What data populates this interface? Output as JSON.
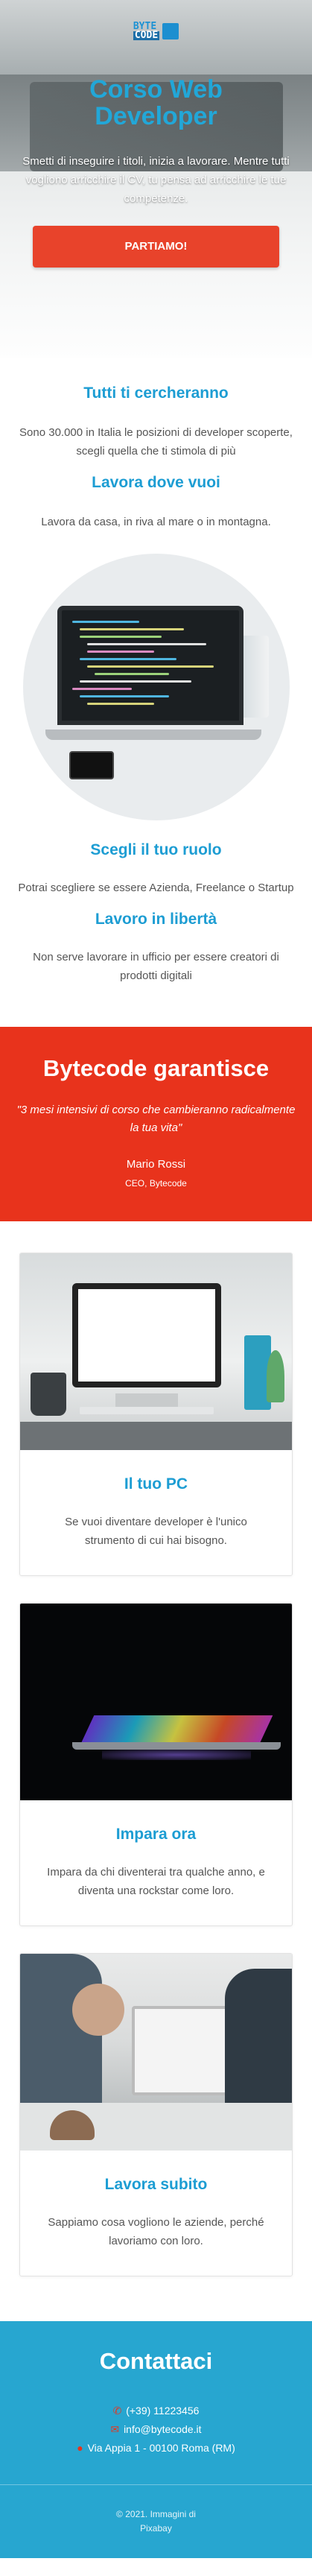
{
  "hero": {
    "logo_line1": "BYTE",
    "logo_line2": "CODE",
    "title_line1": "Corso Web",
    "title_line2": "Developer",
    "text": "Smetti di inseguire i titoli, inizia a lavorare. Mentre tutti vogliono arricchire il CV, tu pensa ad arricchire le tue competenze.",
    "button_label": "PARTIAMO!"
  },
  "features": [
    {
      "title": "Tutti ti cercheranno",
      "text": "Sono 30.000 in Italia le posizioni di developer scoperte, scegli quella che ti stimola di più"
    },
    {
      "title": "Lavora dove vuoi",
      "text": "Lavora da casa, in riva al mare o in montagna."
    },
    {
      "title": "Scegli il tuo ruolo",
      "text": "Potrai scegliere se essere Azienda, Freelance o Startup"
    },
    {
      "title": "Lavoro in libertà",
      "text": "Non serve lavorare in ufficio per essere creatori di prodotti digitali"
    }
  ],
  "guarantee": {
    "title": "Bytecode garantisce",
    "quote": "\"3 mesi intensivi di corso che cambieranno radicalmente la tua vita\"",
    "name": "Mario Rossi",
    "role": "CEO, Bytecode"
  },
  "cards": [
    {
      "title": "Il tuo PC",
      "text": "Se vuoi diventare developer è l'unico strumento di cui hai bisogno."
    },
    {
      "title": "Impara ora",
      "text": "Impara da chi diventerai tra qualche anno, e diventa una rockstar come loro."
    },
    {
      "title": "Lavora subito",
      "text": "Sappiamo cosa vogliono le aziende, perché lavoriamo con loro."
    }
  ],
  "contact": {
    "title": "Contattaci",
    "phone": "(+39) 11223456",
    "email": "info@bytecode.it",
    "address": "Via Appia 1 - 00100 Roma (RM)"
  },
  "footer": {
    "line1": "© 2021. Immagini di",
    "line2": "Pixabay"
  },
  "colors": {
    "accent_blue": "#1d9dd3",
    "accent_red": "#e8331c",
    "contact_bg": "#27a6d0"
  },
  "icons": [
    "phone-icon",
    "envelope-icon",
    "map-pin-icon"
  ]
}
